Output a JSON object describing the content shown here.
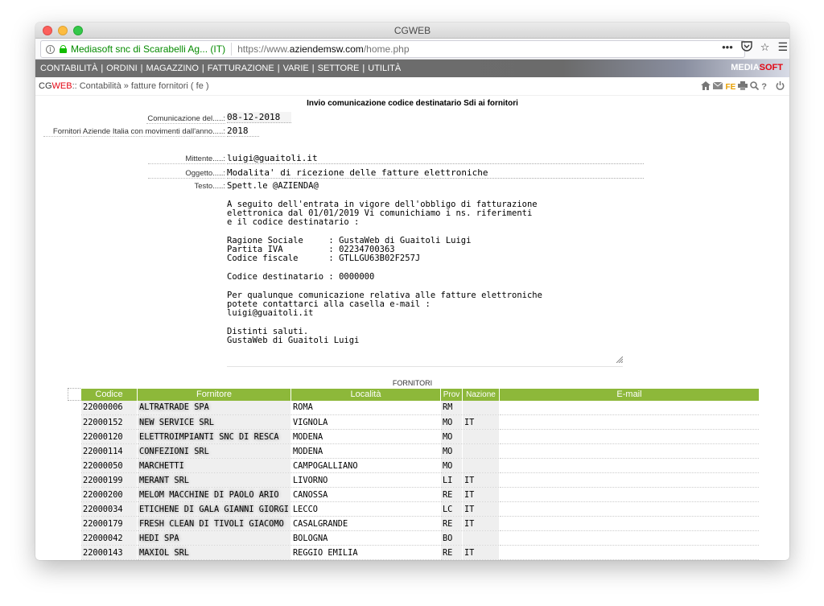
{
  "window": {
    "title": "CGWEB"
  },
  "urlbar": {
    "site_identity": "Mediasoft snc di Scarabelli Ag... (IT)",
    "url_prefix": "https://www.",
    "url_domain": "aziendemsw.com",
    "url_path": "/home.php"
  },
  "nav": {
    "items": [
      "CONTABILITÀ",
      "ORDINI",
      "MAGAZZINO",
      "FATTURAZIONE",
      "VARIE",
      "SETTORE",
      "UTILITÀ"
    ],
    "brand_a": "MEDIA",
    "brand_b": "SOFT"
  },
  "breadcrumb": {
    "app_a": "CG",
    "app_b": "WEB",
    "path": " :: Contabilità » fatture fornitori ( fe )",
    "fe_badge": "FE"
  },
  "form": {
    "heading": "Invio comunicazione codice destinatario Sdi ai fornitori",
    "comunicazione_label": "Comunicazione del.....:",
    "comunicazione_value": "08-12-2018",
    "anno_label": "Fornitori Aziende Italia con movimenti dall'anno.....:",
    "anno_value": "2018",
    "mittente_label": "Mittente.....:",
    "mittente_value": "luigi@guaitoli.it",
    "oggetto_label": "Oggetto.....:",
    "oggetto_value": "Modalita' di ricezione delle fatture elettroniche",
    "testo_label": "Testo.....:",
    "testo_value": "Spett.le @AZIENDA@\n\nA seguito dell'entrata in vigore dell'obbligo di fatturazione\nelettronica dal 01/01/2019 Vi comunichiamo i ns. riferimenti\ne il codice destinatario :\n\nRagione Sociale     : GustaWeb di Guaitoli Luigi\nPartita IVA         : 02234700363\nCodice fiscale      : GTLLGU63B02F257J\n\nCodice destinatario : 0000000\n\nPer qualunque comunicazione relativa alle fatture elettroniche\npotete contattarci alla casella e-mail :\nluigi@guaitoli.it\n\nDistinti saluti.\nGustaWeb di Guaitoli Luigi"
  },
  "table": {
    "caption": "FORNITORI",
    "headers": [
      "Codice",
      "Fornitore",
      "Località",
      "Prov",
      "Nazione",
      "E-mail"
    ],
    "rows": [
      {
        "codice": "22000006",
        "fornitore": "ALTRATRADE SPA",
        "localita": "ROMA",
        "prov": "RM",
        "nazione": ""
      },
      {
        "codice": "22000152",
        "fornitore": "NEW SERVICE SRL",
        "localita": "VIGNOLA",
        "prov": "MO",
        "nazione": "IT"
      },
      {
        "codice": "22000120",
        "fornitore": "ELETTROIMPIANTI SNC DI RESCA",
        "localita": "MODENA",
        "prov": "MO",
        "nazione": ""
      },
      {
        "codice": "22000114",
        "fornitore": "CONFEZIONI SRL",
        "localita": "MODENA",
        "prov": "MO",
        "nazione": ""
      },
      {
        "codice": "22000050",
        "fornitore": "MARCHETTI",
        "localita": "CAMPOGALLIANO",
        "prov": "MO",
        "nazione": ""
      },
      {
        "codice": "22000199",
        "fornitore": "MERANT SRL",
        "localita": "LIVORNO",
        "prov": "LI",
        "nazione": "IT"
      },
      {
        "codice": "22000200",
        "fornitore": "MELOM MACCHINE DI PAOLO ARIO",
        "localita": "CANOSSA",
        "prov": "RE",
        "nazione": "IT"
      },
      {
        "codice": "22000034",
        "fornitore": "ETICHENE DI GALA GIANNI GIORGI",
        "localita": "LECCO",
        "prov": "LC",
        "nazione": "IT"
      },
      {
        "codice": "22000179",
        "fornitore": "FRESH CLEAN DI TIVOLI GIACOMO",
        "localita": "CASALGRANDE",
        "prov": "RE",
        "nazione": "IT"
      },
      {
        "codice": "22000042",
        "fornitore": "HEDI SPA",
        "localita": "BOLOGNA",
        "prov": "BO",
        "nazione": ""
      },
      {
        "codice": "22000143",
        "fornitore": "MAXIOL SRL",
        "localita": "REGGIO EMILIA",
        "prov": "RE",
        "nazione": "IT"
      }
    ]
  }
}
